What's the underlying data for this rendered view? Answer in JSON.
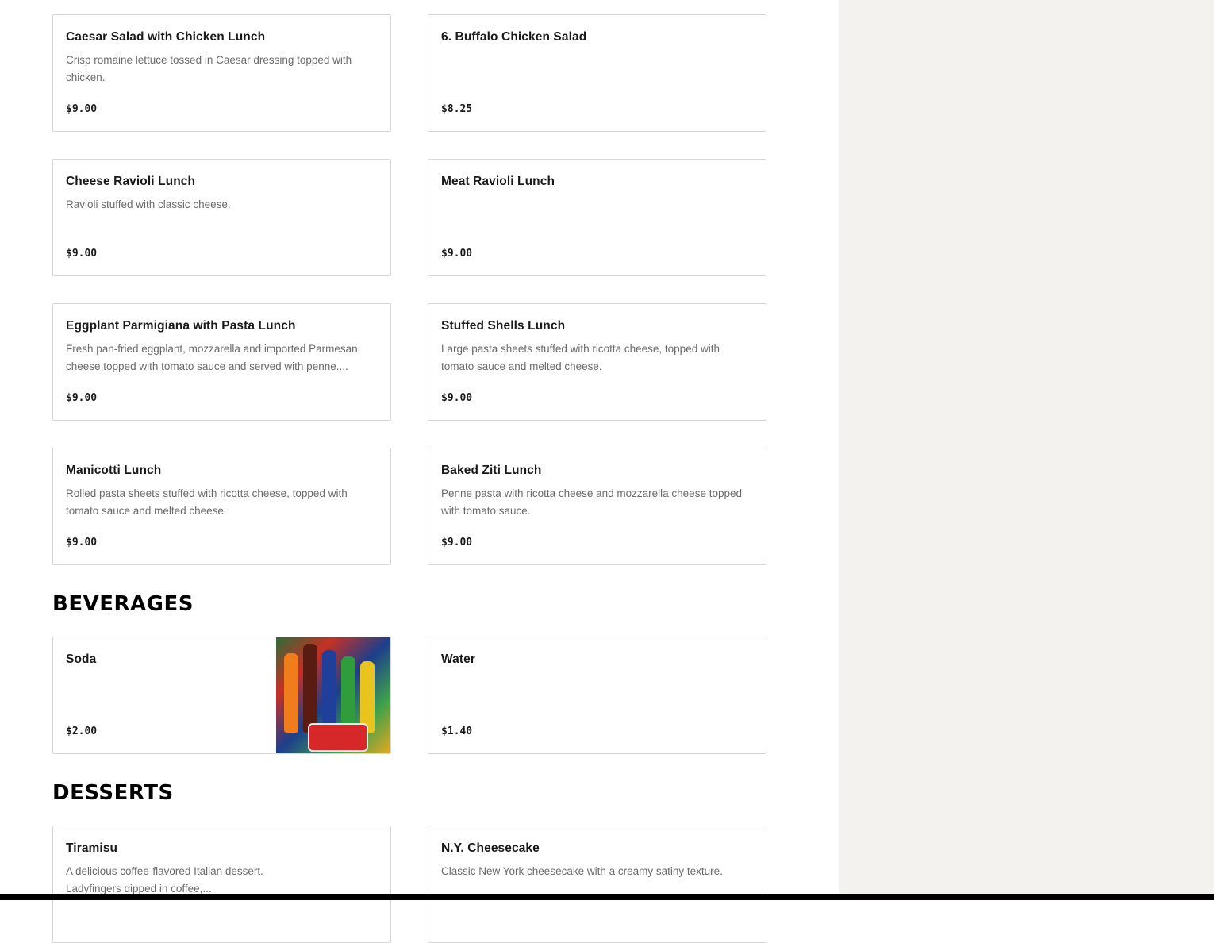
{
  "lunch": [
    {
      "name": "Caesar Salad with Chicken Lunch",
      "desc": "Crisp romaine lettuce tossed in Caesar dressing topped with chicken.",
      "price": "$9.00"
    },
    {
      "name": "6. Buffalo Chicken Salad",
      "desc": "",
      "price": "$8.25"
    },
    {
      "name": "Cheese Ravioli Lunch",
      "desc": "Ravioli stuffed with classic cheese.",
      "price": "$9.00"
    },
    {
      "name": "Meat Ravioli Lunch",
      "desc": "",
      "price": "$9.00"
    },
    {
      "name": "Eggplant Parmigiana with Pasta Lunch",
      "desc": "Fresh pan-fried eggplant, mozzarella and imported Parmesan cheese topped with tomato sauce and served with penne....",
      "price": "$9.00"
    },
    {
      "name": "Stuffed Shells Lunch",
      "desc": "Large pasta sheets stuffed with ricotta cheese, topped with tomato sauce and melted cheese.",
      "price": "$9.00"
    },
    {
      "name": "Manicotti Lunch",
      "desc": "Rolled pasta sheets stuffed with ricotta cheese, topped with tomato sauce and melted cheese.",
      "price": "$9.00"
    },
    {
      "name": "Baked Ziti Lunch",
      "desc": "Penne pasta with ricotta cheese and mozzarella cheese topped with tomato sauce.",
      "price": "$9.00"
    }
  ],
  "beverages": {
    "title": "BEVERAGES",
    "items": [
      {
        "name": "Soda",
        "price": "$2.00",
        "image": "soda-bottles-photo"
      },
      {
        "name": "Water",
        "price": "$1.40"
      }
    ]
  },
  "desserts": {
    "title": "DESSERTS",
    "items": [
      {
        "name": "Tiramisu",
        "desc": "A delicious coffee-flavored Italian dessert. Ladyfingers dipped in coffee,..."
      },
      {
        "name": "N.Y. Cheesecake",
        "desc": "Classic New York cheesecake with a creamy satiny texture."
      }
    ]
  },
  "colors": {
    "sidebar_bg": "#f3f2ef",
    "card_border": "#d6d6d6",
    "desc_text": "#6b6b6b"
  }
}
